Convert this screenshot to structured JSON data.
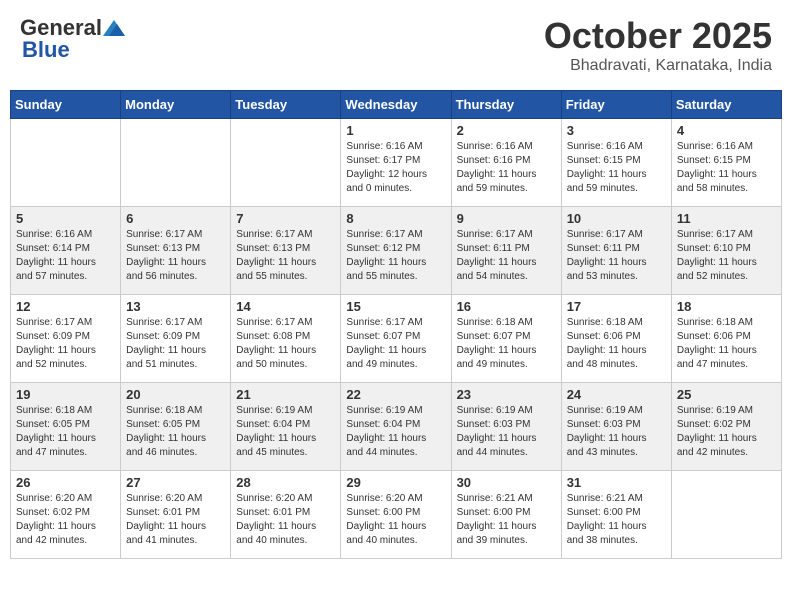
{
  "header": {
    "logo_general": "General",
    "logo_blue": "Blue",
    "month_title": "October 2025",
    "subtitle": "Bhadravati, Karnataka, India"
  },
  "days_of_week": [
    "Sunday",
    "Monday",
    "Tuesday",
    "Wednesday",
    "Thursday",
    "Friday",
    "Saturday"
  ],
  "weeks": [
    [
      {
        "day": "",
        "info": ""
      },
      {
        "day": "",
        "info": ""
      },
      {
        "day": "",
        "info": ""
      },
      {
        "day": "1",
        "info": "Sunrise: 6:16 AM\nSunset: 6:17 PM\nDaylight: 12 hours\nand 0 minutes."
      },
      {
        "day": "2",
        "info": "Sunrise: 6:16 AM\nSunset: 6:16 PM\nDaylight: 11 hours\nand 59 minutes."
      },
      {
        "day": "3",
        "info": "Sunrise: 6:16 AM\nSunset: 6:15 PM\nDaylight: 11 hours\nand 59 minutes."
      },
      {
        "day": "4",
        "info": "Sunrise: 6:16 AM\nSunset: 6:15 PM\nDaylight: 11 hours\nand 58 minutes."
      }
    ],
    [
      {
        "day": "5",
        "info": "Sunrise: 6:16 AM\nSunset: 6:14 PM\nDaylight: 11 hours\nand 57 minutes."
      },
      {
        "day": "6",
        "info": "Sunrise: 6:17 AM\nSunset: 6:13 PM\nDaylight: 11 hours\nand 56 minutes."
      },
      {
        "day": "7",
        "info": "Sunrise: 6:17 AM\nSunset: 6:13 PM\nDaylight: 11 hours\nand 55 minutes."
      },
      {
        "day": "8",
        "info": "Sunrise: 6:17 AM\nSunset: 6:12 PM\nDaylight: 11 hours\nand 55 minutes."
      },
      {
        "day": "9",
        "info": "Sunrise: 6:17 AM\nSunset: 6:11 PM\nDaylight: 11 hours\nand 54 minutes."
      },
      {
        "day": "10",
        "info": "Sunrise: 6:17 AM\nSunset: 6:11 PM\nDaylight: 11 hours\nand 53 minutes."
      },
      {
        "day": "11",
        "info": "Sunrise: 6:17 AM\nSunset: 6:10 PM\nDaylight: 11 hours\nand 52 minutes."
      }
    ],
    [
      {
        "day": "12",
        "info": "Sunrise: 6:17 AM\nSunset: 6:09 PM\nDaylight: 11 hours\nand 52 minutes."
      },
      {
        "day": "13",
        "info": "Sunrise: 6:17 AM\nSunset: 6:09 PM\nDaylight: 11 hours\nand 51 minutes."
      },
      {
        "day": "14",
        "info": "Sunrise: 6:17 AM\nSunset: 6:08 PM\nDaylight: 11 hours\nand 50 minutes."
      },
      {
        "day": "15",
        "info": "Sunrise: 6:17 AM\nSunset: 6:07 PM\nDaylight: 11 hours\nand 49 minutes."
      },
      {
        "day": "16",
        "info": "Sunrise: 6:18 AM\nSunset: 6:07 PM\nDaylight: 11 hours\nand 49 minutes."
      },
      {
        "day": "17",
        "info": "Sunrise: 6:18 AM\nSunset: 6:06 PM\nDaylight: 11 hours\nand 48 minutes."
      },
      {
        "day": "18",
        "info": "Sunrise: 6:18 AM\nSunset: 6:06 PM\nDaylight: 11 hours\nand 47 minutes."
      }
    ],
    [
      {
        "day": "19",
        "info": "Sunrise: 6:18 AM\nSunset: 6:05 PM\nDaylight: 11 hours\nand 47 minutes."
      },
      {
        "day": "20",
        "info": "Sunrise: 6:18 AM\nSunset: 6:05 PM\nDaylight: 11 hours\nand 46 minutes."
      },
      {
        "day": "21",
        "info": "Sunrise: 6:19 AM\nSunset: 6:04 PM\nDaylight: 11 hours\nand 45 minutes."
      },
      {
        "day": "22",
        "info": "Sunrise: 6:19 AM\nSunset: 6:04 PM\nDaylight: 11 hours\nand 44 minutes."
      },
      {
        "day": "23",
        "info": "Sunrise: 6:19 AM\nSunset: 6:03 PM\nDaylight: 11 hours\nand 44 minutes."
      },
      {
        "day": "24",
        "info": "Sunrise: 6:19 AM\nSunset: 6:03 PM\nDaylight: 11 hours\nand 43 minutes."
      },
      {
        "day": "25",
        "info": "Sunrise: 6:19 AM\nSunset: 6:02 PM\nDaylight: 11 hours\nand 42 minutes."
      }
    ],
    [
      {
        "day": "26",
        "info": "Sunrise: 6:20 AM\nSunset: 6:02 PM\nDaylight: 11 hours\nand 42 minutes."
      },
      {
        "day": "27",
        "info": "Sunrise: 6:20 AM\nSunset: 6:01 PM\nDaylight: 11 hours\nand 41 minutes."
      },
      {
        "day": "28",
        "info": "Sunrise: 6:20 AM\nSunset: 6:01 PM\nDaylight: 11 hours\nand 40 minutes."
      },
      {
        "day": "29",
        "info": "Sunrise: 6:20 AM\nSunset: 6:00 PM\nDaylight: 11 hours\nand 40 minutes."
      },
      {
        "day": "30",
        "info": "Sunrise: 6:21 AM\nSunset: 6:00 PM\nDaylight: 11 hours\nand 39 minutes."
      },
      {
        "day": "31",
        "info": "Sunrise: 6:21 AM\nSunset: 6:00 PM\nDaylight: 11 hours\nand 38 minutes."
      },
      {
        "day": "",
        "info": ""
      }
    ]
  ]
}
